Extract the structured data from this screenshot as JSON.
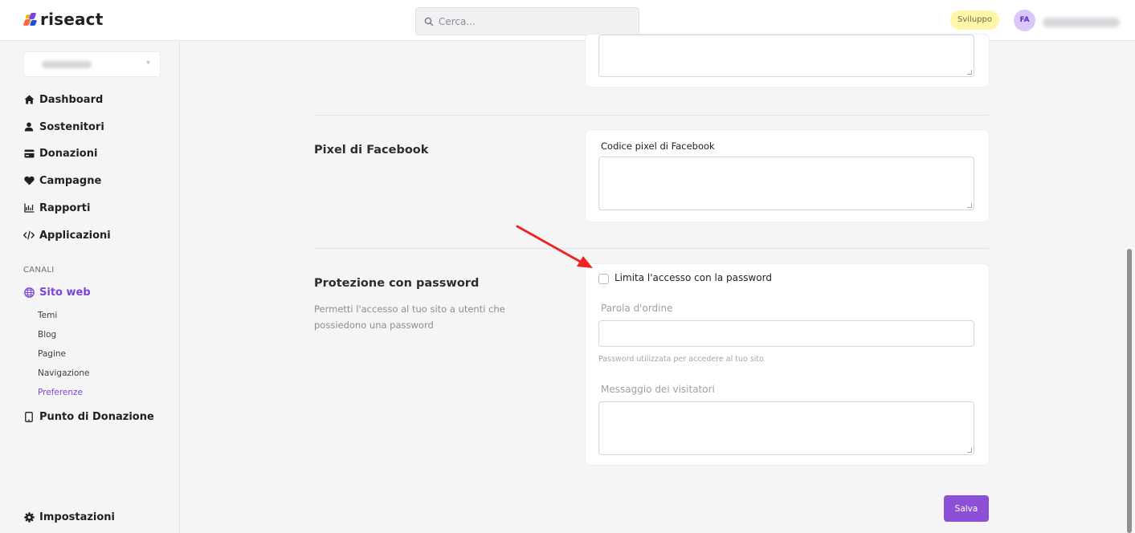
{
  "app": {
    "logo_text": "riseact",
    "env_badge": "Sviluppo",
    "avatar_initials": "FA"
  },
  "search": {
    "placeholder": "Cerca..."
  },
  "sidebar": {
    "items": [
      {
        "label": "Dashboard",
        "icon": "home-icon"
      },
      {
        "label": "Sostenitori",
        "icon": "user-icon"
      },
      {
        "label": "Donazioni",
        "icon": "credit-card-icon"
      },
      {
        "label": "Campagne",
        "icon": "heart-icon"
      },
      {
        "label": "Rapporti",
        "icon": "chart-icon"
      },
      {
        "label": "Applicazioni",
        "icon": "code-icon"
      }
    ],
    "section_label": "CANALI",
    "channel": {
      "label": "Sito web",
      "icon": "globe-icon"
    },
    "sub_items": [
      "Temi",
      "Blog",
      "Pagine",
      "Navigazione",
      "Preferenze"
    ],
    "active_sub_item": "Preferenze",
    "point": {
      "label": "Punto di Donazione",
      "icon": "mobile-icon"
    },
    "settings": {
      "label": "Impostazioni",
      "icon": "gear-icon"
    }
  },
  "facebook": {
    "title": "Pixel di Facebook",
    "field_label": "Codice pixel di Facebook",
    "value": ""
  },
  "password": {
    "title": "Protezione con password",
    "description": "Permetti l'accesso al tuo sito a utenti che possiedono una password",
    "checkbox_label": "Limita l'accesso con la password",
    "checked": false,
    "password_label": "Parola d'ordine",
    "password_help": "Password utilizzata per accedere al tuo sito",
    "message_label": "Messaggio dei visitatori"
  },
  "actions": {
    "save_label": "Salva"
  },
  "colors": {
    "accent": "#8d4fd6",
    "active_nav": "#7b45d9",
    "annotation_arrow": "#ee2424",
    "dev_badge": "#fff7a8"
  }
}
